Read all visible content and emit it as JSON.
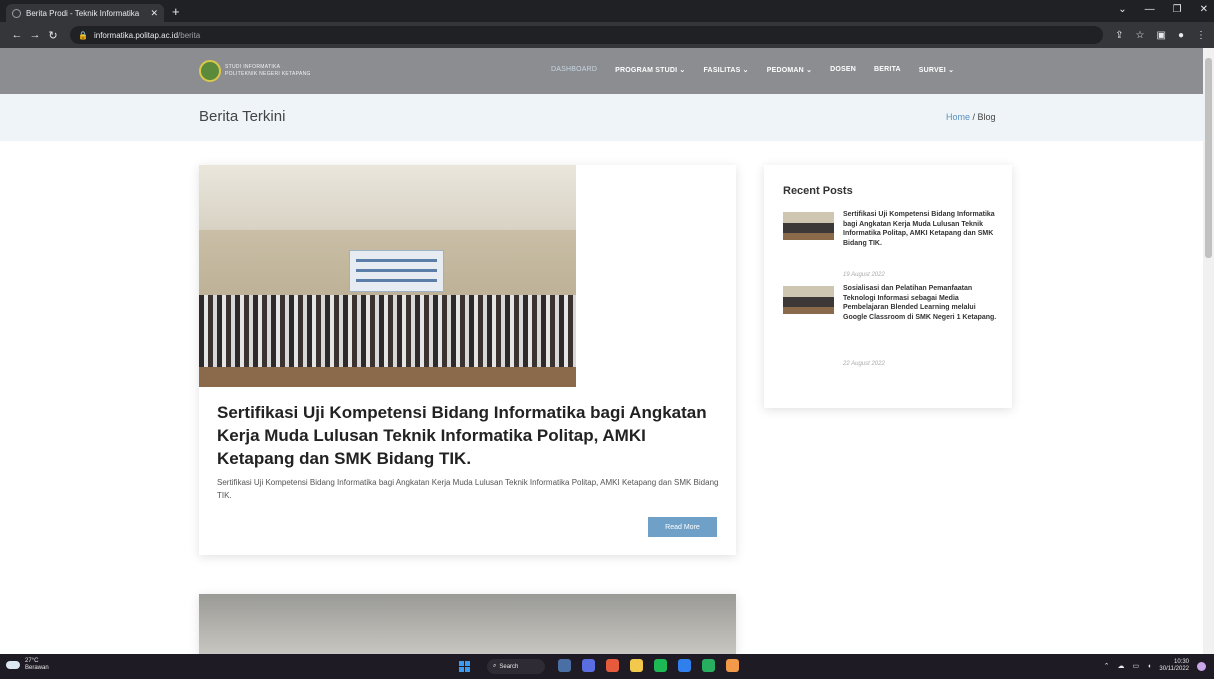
{
  "browser": {
    "tab_title": "Berita Prodi - Teknik Informatika",
    "tab_close": "✕",
    "new_tab": "+",
    "url_domain": "informatika.politap.ac.id",
    "url_path": "/berita",
    "window_controls": [
      "⌄",
      "—",
      "❐",
      "✕"
    ]
  },
  "site": {
    "logo_line1": "STUDI INFORMATIKA",
    "logo_line2": "POLITEKNIK NEGERI KETAPANG",
    "menu": [
      "DASHBOARD",
      "PROGRAM STUDI ⌄",
      "FASILITAS ⌄",
      "PEDOMAN ⌄",
      "DOSEN",
      "BERITA",
      "SURVEI ⌄"
    ]
  },
  "breadcrumbs": {
    "title": "Berita Terkini",
    "home": "Home",
    "separator": " / ",
    "current": "Blog"
  },
  "post": {
    "title": "Sertifikasi Uji Kompetensi Bidang Informatika bagi Angkatan Kerja Muda Lulusan Teknik Informatika Politap, AMKI Ketapang dan SMK Bidang TIK.",
    "excerpt": "Sertifikasi Uji Kompetensi Bidang Informatika bagi Angkatan Kerja Muda Lulusan Teknik Informatika Politap, AMKI Ketapang dan SMK Bidang TIK.",
    "read_more": "Read More"
  },
  "sidebar": {
    "title": "Recent Posts",
    "items": [
      {
        "title": "Sertifikasi Uji Kompetensi Bidang Informatika bagi Angkatan Kerja Muda Lulusan Teknik Informatika Politap, AMKI Ketapang dan SMK Bidang TIK.",
        "date": "19 August 2022"
      },
      {
        "title": "Sosialisasi dan Pelatihan Pemanfaatan Teknologi Informasi sebagai Media Pembelajaran Blended Learning melalui Google Classroom di SMK Negeri 1 Ketapang.",
        "date": "22 August 2022"
      }
    ]
  },
  "taskbar": {
    "temp": "27°C",
    "weather": "Berawan",
    "search": "Search",
    "time": "10:30",
    "date": "30/11/2022"
  }
}
